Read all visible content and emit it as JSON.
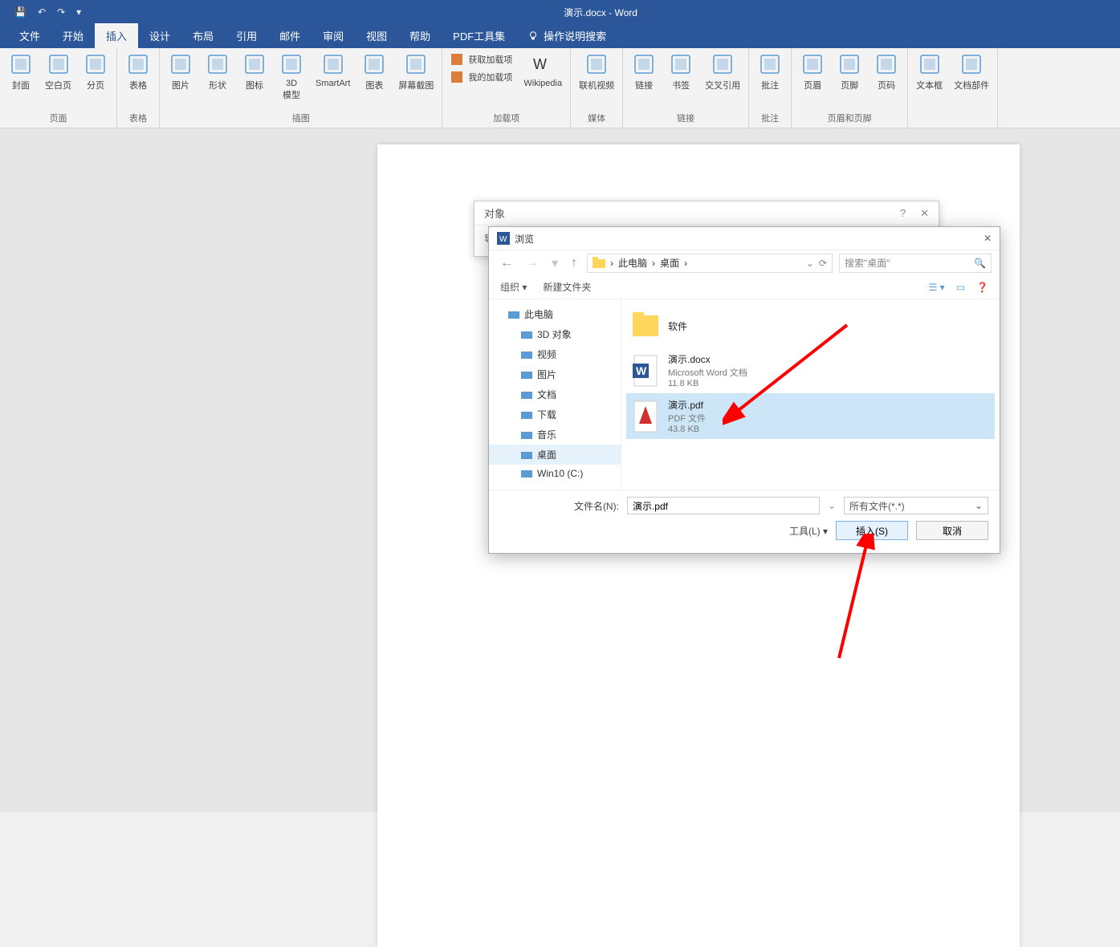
{
  "app": {
    "title": "演示.docx - Word"
  },
  "qat": {
    "save": "💾",
    "undo": "↶",
    "redo": "↷"
  },
  "tabs": [
    "文件",
    "开始",
    "插入",
    "设计",
    "布局",
    "引用",
    "邮件",
    "审阅",
    "视图",
    "帮助",
    "PDF工具集"
  ],
  "active_tab_index": 2,
  "tell_me": "操作说明搜索",
  "ribbon": {
    "groups": [
      {
        "label": "页面",
        "items": [
          {
            "k": "封面",
            "n": "cover-page"
          },
          {
            "k": "空白页",
            "n": "blank-page"
          },
          {
            "k": "分页",
            "n": "page-break"
          }
        ]
      },
      {
        "label": "表格",
        "items": [
          {
            "k": "表格",
            "n": "table"
          }
        ]
      },
      {
        "label": "插图",
        "items": [
          {
            "k": "图片",
            "n": "pictures"
          },
          {
            "k": "形状",
            "n": "shapes"
          },
          {
            "k": "图标",
            "n": "icons"
          },
          {
            "k": "3D\n模型",
            "n": "3d-models"
          },
          {
            "k": "SmartArt",
            "n": "smartart"
          },
          {
            "k": "图表",
            "n": "chart"
          },
          {
            "k": "屏幕截图",
            "n": "screenshot"
          }
        ]
      },
      {
        "label": "加载项",
        "rows": [
          {
            "k": "获取加载项",
            "n": "get-addins"
          },
          {
            "k": "我的加载项",
            "n": "my-addins"
          }
        ],
        "side": {
          "k": "Wikipedia",
          "n": "wikipedia"
        }
      },
      {
        "label": "媒体",
        "items": [
          {
            "k": "联机视频",
            "n": "online-video"
          }
        ]
      },
      {
        "label": "链接",
        "items": [
          {
            "k": "链接",
            "n": "link"
          },
          {
            "k": "书签",
            "n": "bookmark"
          },
          {
            "k": "交叉引用",
            "n": "cross-reference"
          }
        ]
      },
      {
        "label": "批注",
        "items": [
          {
            "k": "批注",
            "n": "comment"
          }
        ]
      },
      {
        "label": "页眉和页脚",
        "items": [
          {
            "k": "页眉",
            "n": "header"
          },
          {
            "k": "页脚",
            "n": "footer"
          },
          {
            "k": "页码",
            "n": "page-number"
          }
        ]
      },
      {
        "label": "",
        "items": [
          {
            "k": "文本框",
            "n": "text-box"
          },
          {
            "k": "文档部件",
            "n": "quick-parts"
          }
        ]
      }
    ]
  },
  "object_dialog": {
    "title": "对象",
    "body_label": "导"
  },
  "browse": {
    "title": "浏览",
    "breadcrumb": [
      "此电脑",
      "桌面"
    ],
    "search_placeholder": "搜索\"桌面\"",
    "organize": "组织",
    "new_folder": "新建文件夹",
    "tree": [
      {
        "label": "此电脑",
        "n": "this-pc",
        "sub": false
      },
      {
        "label": "3D 对象",
        "n": "3d-objects",
        "sub": true
      },
      {
        "label": "视频",
        "n": "videos",
        "sub": true
      },
      {
        "label": "图片",
        "n": "pictures",
        "sub": true
      },
      {
        "label": "文档",
        "n": "documents",
        "sub": true
      },
      {
        "label": "下载",
        "n": "downloads",
        "sub": true
      },
      {
        "label": "音乐",
        "n": "music",
        "sub": true
      },
      {
        "label": "桌面",
        "n": "desktop",
        "sub": true,
        "sel": true
      },
      {
        "label": "Win10 (C:)",
        "n": "drive-c",
        "sub": true
      }
    ],
    "files": [
      {
        "name": "软件",
        "type": "folder",
        "meta1": "",
        "meta2": ""
      },
      {
        "name": "演示.docx",
        "type": "word",
        "meta1": "Microsoft Word 文档",
        "meta2": "11.8 KB"
      },
      {
        "name": "演示.pdf",
        "type": "pdf",
        "meta1": "PDF 文件",
        "meta2": "43.8 KB",
        "sel": true
      }
    ],
    "filename_label": "文件名(N):",
    "filename_value": "演示.pdf",
    "filter": "所有文件(*.*)",
    "tools": "工具(L)",
    "insert": "插入(S)",
    "cancel": "取消"
  }
}
